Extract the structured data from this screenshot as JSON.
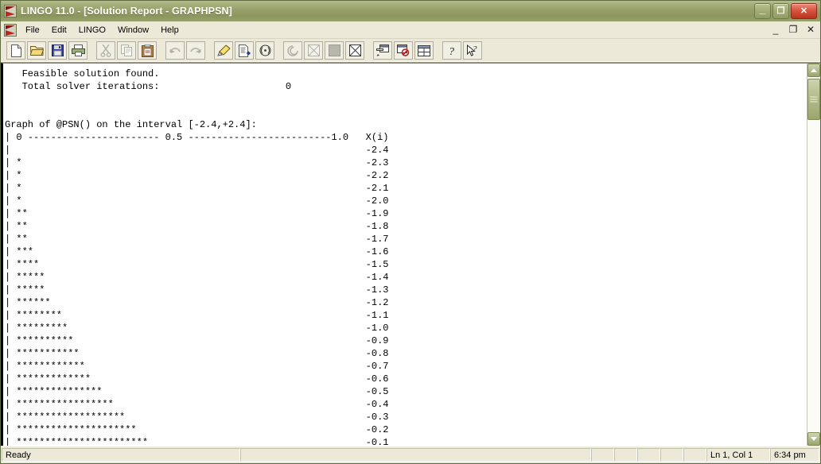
{
  "window": {
    "title": "LINGO 11.0 - [Solution Report - GRAPHPSN]",
    "minimize_label": "–",
    "restore_label": "❐",
    "close_label": "✕",
    "accent_title_bg": "#95 9e68",
    "mdi_minimize_label": "_",
    "mdi_restore_label": "❐",
    "mdi_close_label": "✕"
  },
  "menu": {
    "items": [
      {
        "label": "File"
      },
      {
        "label": "Edit"
      },
      {
        "label": "LINGO"
      },
      {
        "label": "Window"
      },
      {
        "label": "Help"
      }
    ]
  },
  "toolbar": {
    "buttons": [
      {
        "name": "new-file-button",
        "icon": "new-file-icon",
        "enabled": true
      },
      {
        "name": "open-file-button",
        "icon": "open-folder-icon",
        "enabled": true
      },
      {
        "name": "save-button",
        "icon": "floppy-disk-icon",
        "enabled": true
      },
      {
        "name": "print-button",
        "icon": "printer-icon",
        "enabled": true
      },
      {
        "name": "cut-button",
        "icon": "scissors-icon",
        "enabled": false
      },
      {
        "name": "copy-button",
        "icon": "copy-pages-icon",
        "enabled": false
      },
      {
        "name": "paste-button",
        "icon": "clipboard-icon",
        "enabled": true
      },
      {
        "name": "undo-button",
        "icon": "undo-arrow-icon",
        "enabled": false
      },
      {
        "name": "redo-button",
        "icon": "redo-arrow-icon",
        "enabled": false
      },
      {
        "name": "solve-button",
        "icon": "bullseye-target-icon",
        "enabled": true
      },
      {
        "name": "solution-report-button",
        "icon": "document-arrow-icon",
        "enabled": true
      },
      {
        "name": "range-button",
        "icon": "parentheses-dot-icon",
        "enabled": true
      },
      {
        "name": "options-button",
        "icon": "spiral-icon",
        "enabled": false
      },
      {
        "name": "picture-button",
        "icon": "crossed-grid-icon",
        "enabled": false
      },
      {
        "name": "debug-button",
        "icon": "filled-square-icon",
        "enabled": false
      },
      {
        "name": "model-statistics-button",
        "icon": "boxed-x-icon",
        "enabled": true
      },
      {
        "name": "tile-windows-button",
        "icon": "cascade-windows-icon",
        "enabled": true
      },
      {
        "name": "close-all-windows-button",
        "icon": "window-clock-icon",
        "enabled": true
      },
      {
        "name": "arrange-icons-button",
        "icon": "split-window-icon",
        "enabled": true
      },
      {
        "name": "help-button",
        "icon": "question-mark-icon",
        "enabled": true
      },
      {
        "name": "context-help-button",
        "icon": "arrow-question-icon",
        "enabled": true
      }
    ]
  },
  "report": {
    "text": "   Feasible solution found.\n   Total solver iterations:                      0\n\n\nGraph of @PSN() on the interval [-2.4,+2.4]:\n| 0 ----------------------- 0.5 -------------------------1.0   X(i)\n|                                                              -2.4\n| *                                                            -2.3\n| *                                                            -2.2\n| *                                                            -2.1\n| *                                                            -2.0\n| **                                                           -1.9\n| **                                                           -1.8\n| **                                                           -1.7\n| ***                                                          -1.6\n| ****                                                         -1.5\n| *****                                                        -1.4\n| *****                                                        -1.3\n| ******                                                       -1.2\n| ********                                                     -1.1\n| *********                                                    -1.0\n| **********                                                   -0.9\n| ***********                                                  -0.8\n| ************                                                 -0.7\n| *************                                                -0.6\n| ***************                                              -0.5\n| *****************                                            -0.4\n| *******************                                          -0.3\n| *********************                                        -0.2\n| ***********************                                      -0.1"
  },
  "scrollbar": {
    "up_arrow": "▲",
    "down_arrow": "▼",
    "thumb_name": "vertical-scroll-thumb"
  },
  "statusbar": {
    "status_text": "Ready",
    "middle_text": "",
    "panel1": "",
    "panel2": "",
    "panel3": "",
    "panel4": "",
    "panel5": "",
    "cursor_position": "Ln 1, Col 1",
    "clock": "6:34 pm"
  }
}
